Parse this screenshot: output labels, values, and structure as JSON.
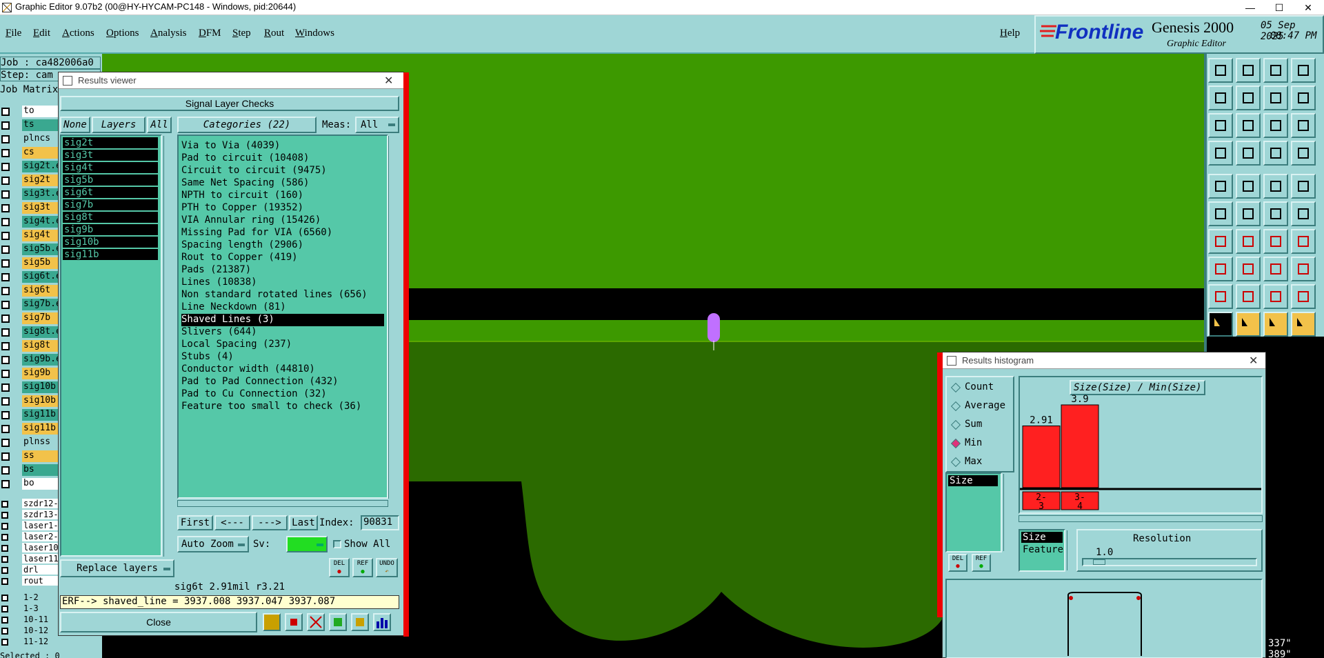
{
  "window": {
    "title": "Graphic Editor 9.07b2 (00@HY-HYCAM-PC148 - Windows, pid:20644)",
    "minimize": "—",
    "maximize": "☐",
    "close": "✕"
  },
  "menu": [
    "File",
    "Edit",
    "Actions",
    "Options",
    "Analysis",
    "DFM",
    "Step",
    "Rout",
    "Windows"
  ],
  "help": "Help",
  "logo": {
    "brand": "Frontline",
    "product": "Genesis 2000",
    "subtitle": "Graphic Editor",
    "date": "05 Sep 2025",
    "time": "08:47 PM"
  },
  "left": {
    "job": "Job : ca482006a0",
    "step": "Step: cam",
    "matrix": "Job Matrix",
    "layers": [
      {
        "name": "to",
        "bg": "#ffffff"
      },
      {
        "name": "ts",
        "bg": "#3aa890"
      },
      {
        "name": "plncs",
        "bg": "#9fd6d6"
      },
      {
        "name": "cs",
        "bg": "#f2c24a"
      },
      {
        "name": "sig2t.e",
        "bg": "#3aa890"
      },
      {
        "name": "sig2t",
        "bg": "#f2c24a"
      },
      {
        "name": "sig3t.e",
        "bg": "#3aa890"
      },
      {
        "name": "sig3t",
        "bg": "#f2c24a"
      },
      {
        "name": "sig4t.e",
        "bg": "#3aa890"
      },
      {
        "name": "sig4t",
        "bg": "#f2c24a"
      },
      {
        "name": "sig5b.e",
        "bg": "#3aa890"
      },
      {
        "name": "sig5b",
        "bg": "#f2c24a"
      },
      {
        "name": "sig6t.e",
        "bg": "#3aa890"
      },
      {
        "name": "sig6t",
        "bg": "#f2c24a"
      },
      {
        "name": "sig7b.e",
        "bg": "#3aa890"
      },
      {
        "name": "sig7b",
        "bg": "#f2c24a"
      },
      {
        "name": "sig8t.e",
        "bg": "#3aa890"
      },
      {
        "name": "sig8t",
        "bg": "#f2c24a"
      },
      {
        "name": "sig9b.e",
        "bg": "#3aa890"
      },
      {
        "name": "sig9b",
        "bg": "#f2c24a"
      },
      {
        "name": "sig10b.",
        "bg": "#3aa890"
      },
      {
        "name": "sig10b",
        "bg": "#f2c24a"
      },
      {
        "name": "sig11b.",
        "bg": "#3aa890"
      },
      {
        "name": "sig11b",
        "bg": "#f2c24a"
      },
      {
        "name": "plnss",
        "bg": "#9fd6d6"
      },
      {
        "name": "ss",
        "bg": "#f2c24a"
      },
      {
        "name": "bs",
        "bg": "#3aa890"
      },
      {
        "name": "bo",
        "bg": "#ffffff"
      }
    ],
    "drill_layers": [
      "szdr12-",
      "szdr13-",
      "laser1-",
      "laser2-",
      "laser10",
      "laser11",
      "drl",
      "rout"
    ],
    "pairs": [
      "1-2",
      "1-3",
      "10-11",
      "10-12",
      "11-12"
    ],
    "selected": "Selected : 0"
  },
  "results_viewer": {
    "title": "Results viewer",
    "header": "Signal Layer Checks",
    "none": "None",
    "layers": "Layers",
    "all": "All",
    "categories_label": "Categories (22)",
    "meas_label": "Meas:",
    "meas_value": "All",
    "signal_layers": [
      "sig2t",
      "sig3t",
      "sig4t",
      "sig5b",
      "sig6t",
      "sig7b",
      "sig8t",
      "sig9b",
      "sig10b",
      "sig11b"
    ],
    "categories": [
      "Via to Via (4039)",
      "Pad to circuit (10408)",
      "Circuit to circuit (9475)",
      "Same Net Spacing (586)",
      "NPTH to circuit (160)",
      "PTH to Copper (19352)",
      "VIA Annular ring (15426)",
      "Missing Pad for VIA (6560)",
      "Spacing length (2906)",
      "Rout to Copper (419)",
      "Pads (21387)",
      "Lines (10838)",
      "Non standard rotated lines (656)",
      "Line Neckdown (81)",
      "Shaved Lines (3)",
      "Slivers (644)",
      "Local Spacing (237)",
      "Stubs (4)",
      "Conductor width (44810)",
      "Pad to Pad Connection (432)",
      "Pad to Cu Connection (32)",
      "Feature too small to check (36)"
    ],
    "selected_category_index": 14,
    "first": "First",
    "prev": "<---",
    "next": "--->",
    "last": "Last",
    "index_label": "Index:",
    "index_value": "90831",
    "auto_zoom": "Auto Zoom",
    "sv_label": "Sv:",
    "show_all": "Show All",
    "replace_layers": "Replace layers",
    "del": "DEL",
    "ref": "REF",
    "undo": "UNDO",
    "status": "sig6t 2.91mil  r3.21",
    "erf": "ERF--> shaved_line = 3937.008 3937.047 3937.087",
    "close": "Close"
  },
  "histogram": {
    "title": "Results histogram",
    "options": [
      "Count",
      "Average",
      "Sum",
      "Min",
      "Max"
    ],
    "selected_option": "Min",
    "list_item": "Size",
    "chart_title": "Size(Size) / Min(Size)",
    "del": "DEL",
    "ref": "REF",
    "sort_items": [
      "Size",
      "Feature"
    ],
    "resolution_label": "Resolution",
    "resolution_value": "1.0",
    "coord1": "337\"",
    "coord2": "389\""
  },
  "chart_data": {
    "type": "bar",
    "title": "Size(Size) / Min(Size)",
    "categories": [
      "2-3",
      "3-4"
    ],
    "values": [
      2.91,
      3.9
    ],
    "data_labels": [
      "2.91",
      "3.9"
    ],
    "bar_color": "#ff2020"
  },
  "colors": {
    "ui_teal": "#9fd6d6",
    "list_green": "#55c8a8",
    "pcb_green": "#3d9900",
    "pcb_dark": "#2b6a00",
    "highlight_red": "#e00000",
    "feature_purple": "#c070ff"
  }
}
